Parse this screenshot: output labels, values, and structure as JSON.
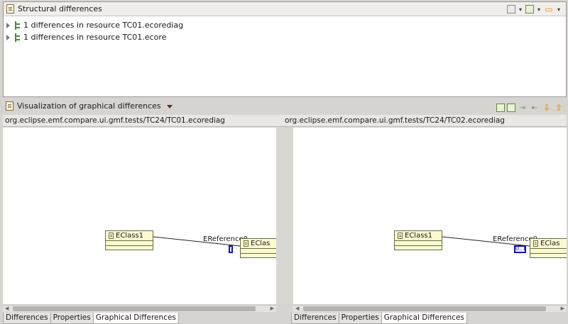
{
  "structural_panel": {
    "title": "Structural differences",
    "toolbar_icons": [
      "save-icon",
      "dropdown-icon",
      "filter-icon",
      "dropdown-icon",
      "open-folder-icon",
      "dropdown-icon"
    ],
    "items": [
      {
        "label": "1 differences in resource TC01.ecorediag"
      },
      {
        "label": "1 differences in resource TC01.ecore"
      }
    ]
  },
  "viz_panel": {
    "title": "Visualization of graphical differences",
    "toolbar_icons": [
      "copy-left-icon",
      "copy-right-icon",
      "merge-right-icon",
      "merge-left-icon",
      "next-diff-icon",
      "prev-diff-icon"
    ]
  },
  "left_pane": {
    "path": "org.eclipse.emf.compare.ui.gmf.tests/TC24/TC01.ecorediag",
    "class1": "EClass1",
    "reference": "EReference0",
    "class2": "EClas",
    "marker": ""
  },
  "right_pane": {
    "path": "org.eclipse.emf.compare.ui.gmf.tests/TC24/TC02.ecorediag",
    "class1": "EClass1",
    "reference": "EReference0",
    "class2": "EClas",
    "marker": "0..1"
  },
  "tabs": [
    "Differences",
    "Properties",
    "Graphical Differences"
  ],
  "active_tab": "Graphical Differences",
  "colors": {
    "marker": "#1010c0",
    "class_fill": "#fcfad0",
    "diff_icon": "#3f8f3f"
  }
}
